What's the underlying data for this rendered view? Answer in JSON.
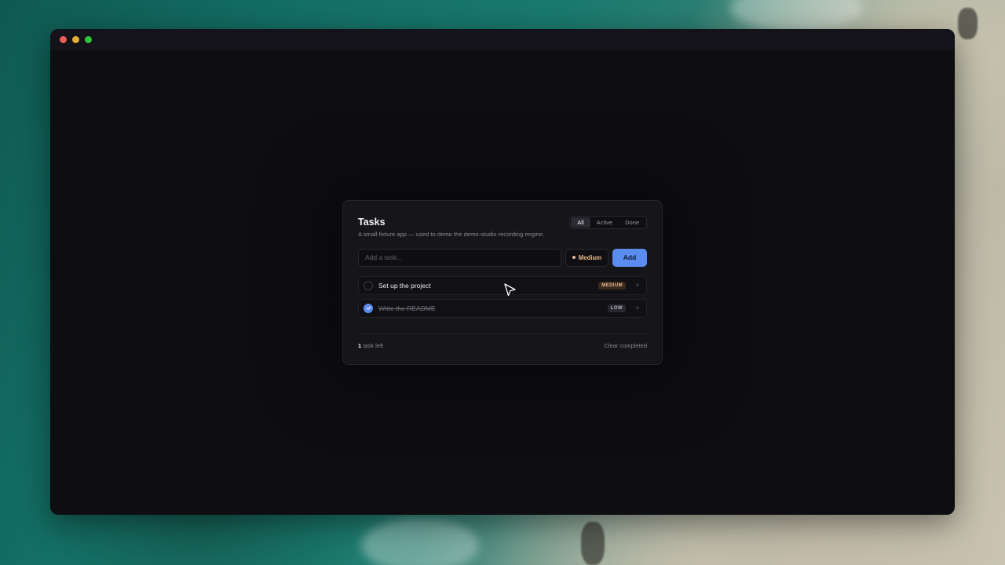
{
  "window": {
    "controls": [
      "close",
      "minimize",
      "maximize"
    ]
  },
  "app": {
    "title": "Tasks",
    "subtitle": "A small fixture app — used to demo the demo-studio recording engine.",
    "filters": [
      {
        "label": "All",
        "active": true
      },
      {
        "label": "Active",
        "active": false
      },
      {
        "label": "Done",
        "active": false
      }
    ],
    "input": {
      "placeholder": "Add a task...",
      "value": ""
    },
    "priority": {
      "label": "Medium",
      "color": "#e8b98a"
    },
    "add_label": "Add",
    "tasks": [
      {
        "label": "Set up the project",
        "done": false,
        "priority": "MEDIUM",
        "remove": "×"
      },
      {
        "label": "Write the README",
        "done": true,
        "priority": "LOW",
        "remove": "×"
      }
    ],
    "footer": {
      "count": "1",
      "count_suffix": "task left",
      "clear_label": "Clear completed"
    }
  },
  "colors": {
    "accent": "#5b8df0",
    "medium": "#e8b98a",
    "window_bg": "#0e0d12"
  }
}
